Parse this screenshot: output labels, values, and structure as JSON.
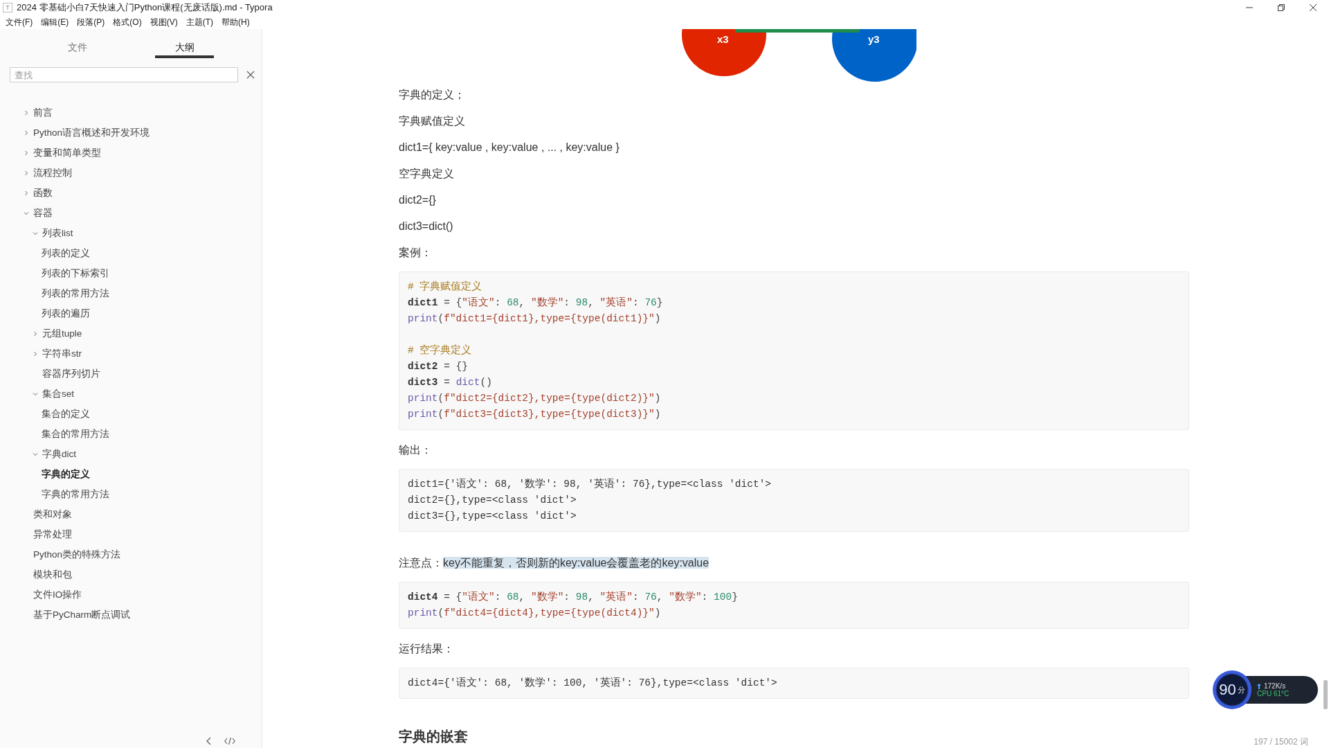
{
  "window": {
    "title": "2024 零基础小白7天快速入门Python课程(无废话版).md - Typora",
    "app_icon": "T"
  },
  "menu": [
    "文件(F)",
    "编辑(E)",
    "段落(P)",
    "格式(O)",
    "视图(V)",
    "主题(T)",
    "帮助(H)"
  ],
  "sidebar": {
    "tabs": [
      {
        "label": "文件",
        "selected": false
      },
      {
        "label": "大纲",
        "selected": true
      }
    ],
    "search": {
      "placeholder": "查找"
    },
    "outline": [
      {
        "label": "前言",
        "expanded": false,
        "selected": false
      },
      {
        "label": "Python语言概述和开发环境",
        "expanded": false,
        "selected": false
      },
      {
        "label": "变量和简单类型",
        "expanded": false,
        "selected": false
      },
      {
        "label": "流程控制",
        "expanded": false,
        "selected": false
      },
      {
        "label": "函数",
        "expanded": false,
        "selected": false
      },
      {
        "label": "容器",
        "expanded": true,
        "selected": false,
        "children": [
          {
            "label": "列表list",
            "expanded": true,
            "selected": false,
            "children": [
              {
                "label": "列表的定义",
                "selected": false
              },
              {
                "label": "列表的下标索引",
                "selected": false
              },
              {
                "label": "列表的常用方法",
                "selected": false
              },
              {
                "label": "列表的遍历",
                "selected": false
              }
            ]
          },
          {
            "label": "元组tuple",
            "expanded": false,
            "selected": false
          },
          {
            "label": "字符串str",
            "expanded": false,
            "selected": false
          },
          {
            "label": "容器序列切片",
            "selected": false
          },
          {
            "label": "集合set",
            "expanded": true,
            "selected": false,
            "children": [
              {
                "label": "集合的定义",
                "selected": false
              },
              {
                "label": "集合的常用方法",
                "selected": false
              }
            ]
          },
          {
            "label": "字典dict",
            "expanded": true,
            "selected": false,
            "children": [
              {
                "label": "字典的定义",
                "selected": true
              },
              {
                "label": "字典的常用方法",
                "selected": false
              }
            ]
          }
        ]
      },
      {
        "label": "类和对象",
        "selected": false
      },
      {
        "label": "异常处理",
        "selected": false
      },
      {
        "label": "Python类的特殊方法",
        "selected": false
      },
      {
        "label": "模块和包",
        "selected": false
      },
      {
        "label": "文件IO操作",
        "selected": false
      },
      {
        "label": "基于PyCharm断点调试",
        "selected": false
      }
    ]
  },
  "document": {
    "figure": {
      "labels": [
        "x3",
        "y3"
      ]
    },
    "blocks": [
      {
        "kind": "text",
        "text": "字典的定义；"
      },
      {
        "kind": "text",
        "text": "字典赋值定义"
      },
      {
        "kind": "text",
        "text": "dict1={ key:value , key:value , ... , key:value }"
      },
      {
        "kind": "text",
        "text": "空字典定义"
      },
      {
        "kind": "text",
        "text": "dict2={}"
      },
      {
        "kind": "text",
        "text": "dict3=dict()"
      },
      {
        "kind": "text",
        "text": "案例："
      },
      {
        "kind": "code",
        "groups": [
          [
            [
              {
                "text": "# 字典赋值定义",
                "kind": "comment"
              }
            ],
            [
              {
                "text": "dict1",
                "kind": "var"
              },
              {
                "text": " = {",
                "kind": "op"
              },
              {
                "text": "\"语文\"",
                "kind": "str"
              },
              {
                "text": ": ",
                "kind": "op"
              },
              {
                "text": "68",
                "kind": "num"
              },
              {
                "text": ", ",
                "kind": "op"
              },
              {
                "text": "\"数学\"",
                "kind": "str"
              },
              {
                "text": ": ",
                "kind": "op"
              },
              {
                "text": "98",
                "kind": "num"
              },
              {
                "text": ", ",
                "kind": "op"
              },
              {
                "text": "\"英语\"",
                "kind": "str"
              },
              {
                "text": ": ",
                "kind": "op"
              },
              {
                "text": "76",
                "kind": "num"
              },
              {
                "text": "}",
                "kind": "op"
              }
            ],
            [
              {
                "text": "print",
                "kind": "builtin"
              },
              {
                "text": "(",
                "kind": "op"
              },
              {
                "text": "f\"dict1={dict1},type={type(dict1)}\"",
                "kind": "str"
              },
              {
                "text": ")",
                "kind": "op"
              }
            ]
          ],
          [
            [
              {
                "text": "# 空字典定义",
                "kind": "comment"
              }
            ],
            [
              {
                "text": "dict2",
                "kind": "var"
              },
              {
                "text": " = {}",
                "kind": "op"
              }
            ],
            [
              {
                "text": "dict3",
                "kind": "var"
              },
              {
                "text": " = ",
                "kind": "op"
              },
              {
                "text": "dict",
                "kind": "builtin"
              },
              {
                "text": "()",
                "kind": "op"
              }
            ],
            [
              {
                "text": "print",
                "kind": "builtin"
              },
              {
                "text": "(",
                "kind": "op"
              },
              {
                "text": "f\"dict2={dict2},type={type(dict2)}\"",
                "kind": "str"
              },
              {
                "text": ")",
                "kind": "op"
              }
            ],
            [
              {
                "text": "print",
                "kind": "builtin"
              },
              {
                "text": "(",
                "kind": "op"
              },
              {
                "text": "f\"dict3={dict3},type={type(dict3)}\"",
                "kind": "str"
              },
              {
                "text": ")",
                "kind": "op"
              }
            ]
          ]
        ]
      },
      {
        "kind": "text",
        "text": "输出："
      },
      {
        "kind": "code",
        "groups": [
          [
            [
              {
                "text": "dict1={'语文': 68, '数学': 98, '英语': 76},type=<class 'dict'>",
                "kind": "plain"
              }
            ],
            [
              {
                "text": "dict2={},type=<class 'dict'>",
                "kind": "plain"
              }
            ],
            [
              {
                "text": "dict3={},type=<class 'dict'>",
                "kind": "plain"
              }
            ]
          ]
        ]
      },
      {
        "kind": "note",
        "text": "注意点：",
        "highlight": "key不能重复，否则新的key:value会覆盖老的key:value",
        "selected": true
      },
      {
        "kind": "code",
        "groups": [
          [
            [
              {
                "text": "dict4",
                "kind": "var"
              },
              {
                "text": " = {",
                "kind": "op"
              },
              {
                "text": "\"语文\"",
                "kind": "str"
              },
              {
                "text": ": ",
                "kind": "op"
              },
              {
                "text": "68",
                "kind": "num"
              },
              {
                "text": ", ",
                "kind": "op"
              },
              {
                "text": "\"数学\"",
                "kind": "str"
              },
              {
                "text": ": ",
                "kind": "op"
              },
              {
                "text": "98",
                "kind": "num"
              },
              {
                "text": ", ",
                "kind": "op"
              },
              {
                "text": "\"英语\"",
                "kind": "str"
              },
              {
                "text": ": ",
                "kind": "op"
              },
              {
                "text": "76",
                "kind": "num"
              },
              {
                "text": ", ",
                "kind": "op"
              },
              {
                "text": "\"数学\"",
                "kind": "str"
              },
              {
                "text": ": ",
                "kind": "op"
              },
              {
                "text": "100",
                "kind": "num"
              },
              {
                "text": "}",
                "kind": "op"
              }
            ],
            [
              {
                "text": "print",
                "kind": "builtin"
              },
              {
                "text": "(",
                "kind": "op"
              },
              {
                "text": "f\"dict4={dict4},type={type(dict4)}\"",
                "kind": "str"
              },
              {
                "text": ")",
                "kind": "op"
              }
            ]
          ]
        ]
      },
      {
        "kind": "text",
        "text": "运行结果："
      },
      {
        "kind": "code",
        "groups": [
          [
            [
              {
                "text": "dict4={'语文': 68, '数学': 100, '英语': 76},type=<class 'dict'>",
                "kind": "plain"
              }
            ]
          ]
        ]
      },
      {
        "kind": "heading",
        "text": "字典的嵌套"
      }
    ]
  },
  "word_count": "197 / 15002 词",
  "monitor": {
    "score": "90",
    "unit": "分",
    "speed": "172K/s",
    "cpu": "CPU 61°C"
  }
}
